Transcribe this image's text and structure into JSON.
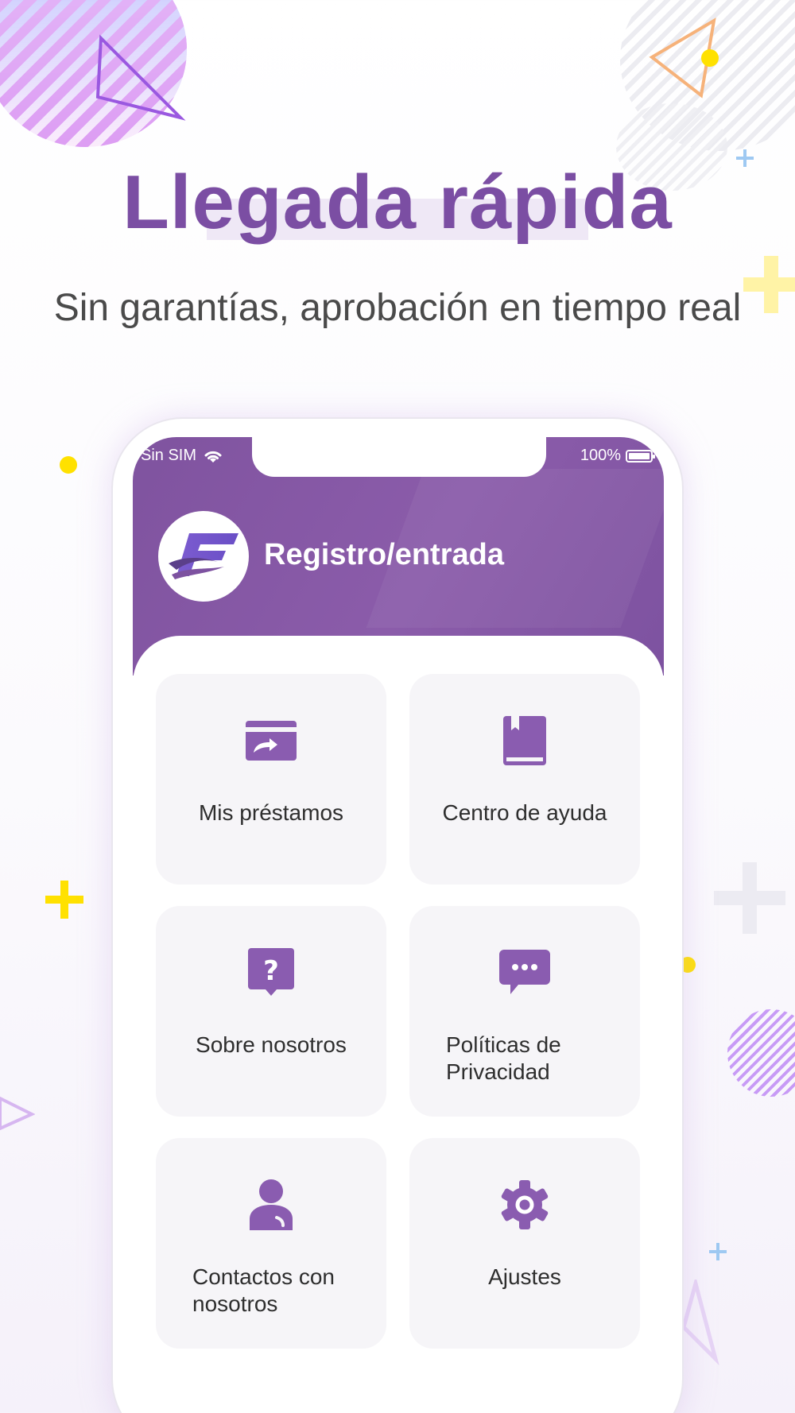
{
  "headline": "Llegada rápida",
  "subtitle": "Sin garantías, aprobación en tiempo real",
  "status_bar": {
    "carrier": "Sin SIM",
    "battery": "100%"
  },
  "header": {
    "title": "Registro/entrada"
  },
  "menu": [
    {
      "label": "Mis préstamos",
      "icon": "card-transfer-icon"
    },
    {
      "label": "Centro de ayuda",
      "icon": "book-icon"
    },
    {
      "label": "Sobre nosotros",
      "icon": "question-bubble-icon"
    },
    {
      "label": "Políticas de Privacidad",
      "icon": "chat-bubble-icon"
    },
    {
      "label": "Contactos con nosotros",
      "icon": "person-icon"
    },
    {
      "label": "Ajustes",
      "icon": "gear-icon"
    }
  ],
  "colors": {
    "brand": "#7f539f",
    "icon": "#8a5cb0",
    "accent_yellow": "#ffe100"
  }
}
